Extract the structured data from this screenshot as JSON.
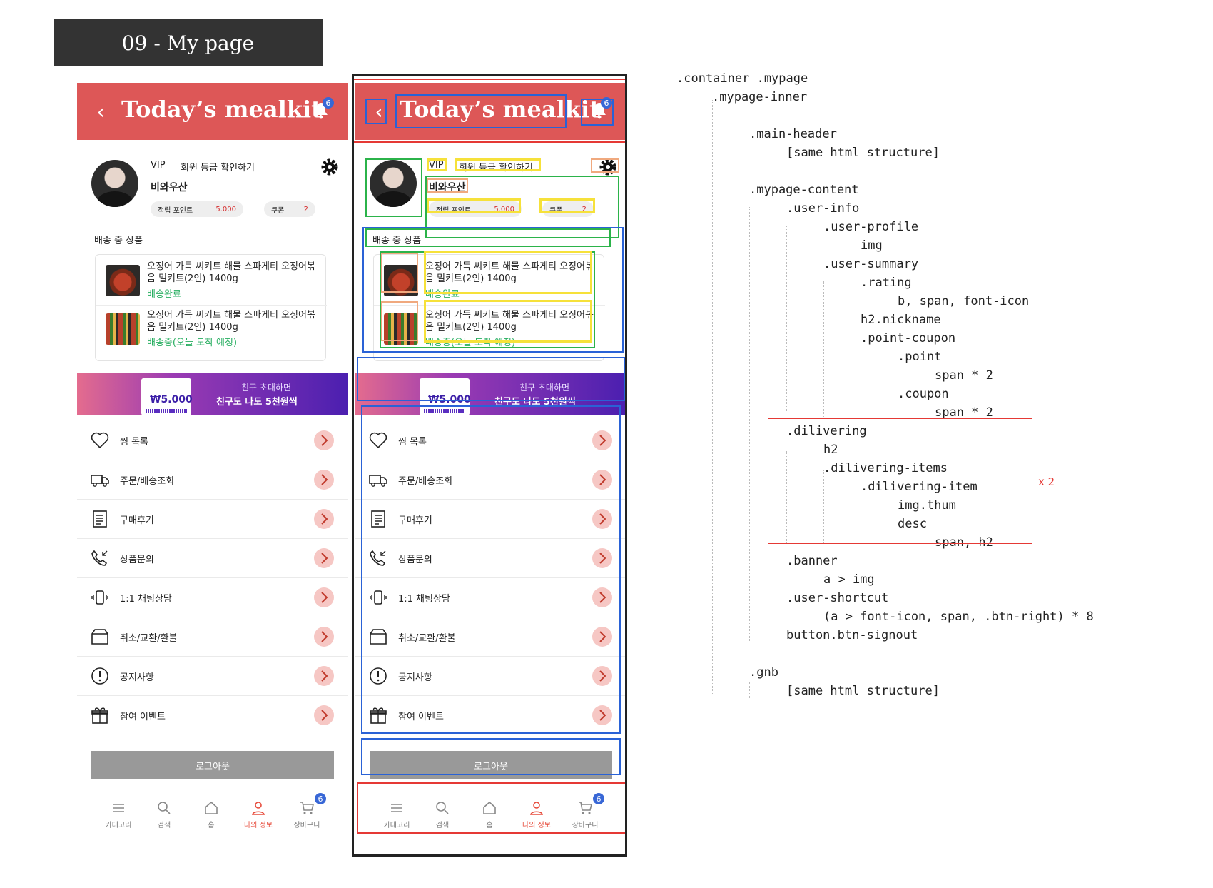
{
  "doc_title": "09 - My page",
  "header": {
    "back_icon": "chevron-left-icon",
    "brand": "Today’s mealkit",
    "bell_icon": "bell-icon",
    "notification_count": "6"
  },
  "profile": {
    "grade": "VIP",
    "grade_link": "회원 등급 확인하기",
    "nickname": "비와우산",
    "point_label": "적립 포인트",
    "point_value": "5.000",
    "coupon_label": "쿠폰",
    "coupon_value": "2",
    "settings_icon": "gear-icon"
  },
  "delivering": {
    "title": "배송 중 상품",
    "items": [
      {
        "name": "오징어 가득 씨키트 해물 스파게티 오징어볶음 밀키트(2인) 1400g",
        "status": "배송완료"
      },
      {
        "name": "오징어 가득 씨키트 해물 스파게티 오징어볶음 밀키트(2인) 1400g",
        "status": "배송중(오늘 도착 예정)"
      }
    ]
  },
  "banner": {
    "amount": "₩5.000",
    "line1": "친구 초대하면",
    "line2": "친구도 나도 5천원씩"
  },
  "shortcut": [
    {
      "label": "찜 목록",
      "icon": "heart-icon"
    },
    {
      "label": "주문/배송조회",
      "icon": "truck-icon"
    },
    {
      "label": "구매후기",
      "icon": "receipt-icon"
    },
    {
      "label": "상품문의",
      "icon": "phone-call-icon"
    },
    {
      "label": "1:1 채팅상담",
      "icon": "chat-device-icon"
    },
    {
      "label": "취소/교환/환불",
      "icon": "box-icon"
    },
    {
      "label": "공지사항",
      "icon": "alert-icon"
    },
    {
      "label": "참여 이벤트",
      "icon": "gift-icon"
    }
  ],
  "signout": "로그아웃",
  "gnb": {
    "items": [
      {
        "label": "카테고리",
        "icon": "menu-icon"
      },
      {
        "label": "검색",
        "icon": "search-icon"
      },
      {
        "label": "홈",
        "icon": "home-icon"
      },
      {
        "label": "나의 정보",
        "icon": "user-icon"
      },
      {
        "label": "장바구니",
        "icon": "cart-icon"
      }
    ],
    "cart_count": "6",
    "active_color": "#e74c3c"
  },
  "colors": {
    "header": "#dd5757",
    "status_green": "#27ae60",
    "accent_blue": "#3867d6"
  },
  "code_tree": [
    ".container .mypage",
    ".mypage-inner",
    ".main-header",
    "[same html structure]",
    ".mypage-content",
    ".user-info",
    ".user-profile",
    "img",
    ".user-summary",
    ".rating",
    "b, span, font-icon",
    "h2.nickname",
    ".point-coupon",
    ".point",
    "span * 2",
    ".coupon",
    "span * 2",
    ".dilivering",
    "h2",
    ".dilivering-items",
    ".dilivering-item",
    "img.thum",
    "desc",
    "span, h2",
    ".banner",
    "a > img",
    ".user-shortcut",
    "(a > font-icon, span, .btn-right) * 8",
    "button.btn-signout",
    ".gnb",
    "[same html structure]"
  ],
  "repeat_note": "x 2"
}
